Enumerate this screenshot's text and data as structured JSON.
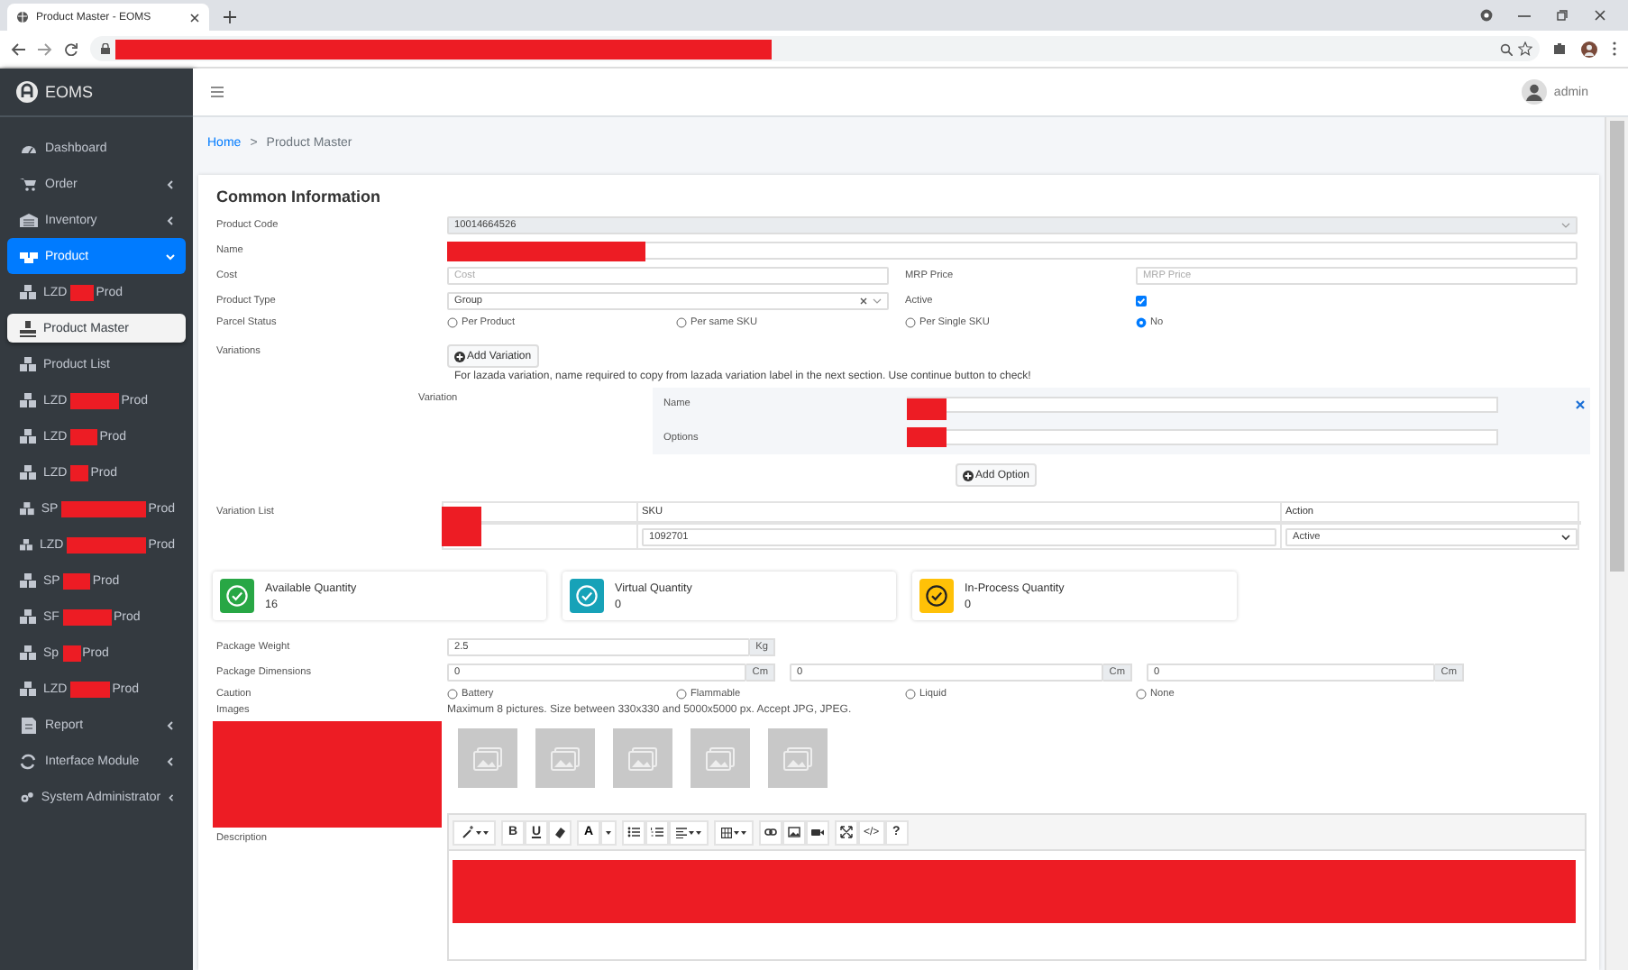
{
  "browser": {
    "tab_title": "Product Master - EOMS"
  },
  "app": {
    "brand": "EOMS",
    "user": "admin"
  },
  "breadcrumb": {
    "items": [
      {
        "label": "Home",
        "link": true
      },
      {
        "label": "Product Master",
        "link": false
      }
    ],
    "separator": ">"
  },
  "sidebar": {
    "items": [
      {
        "label": "Dashboard",
        "selected": false
      },
      {
        "label": "Order",
        "expanded": false,
        "selected": false
      },
      {
        "label": "Inventory",
        "expanded": false,
        "selected": false
      },
      {
        "label": "Product",
        "expanded": true,
        "selected": true,
        "children": [
          {
            "label": "LZD",
            "suffix": "Prod",
            "selected": false
          },
          {
            "label": "Product Master",
            "selected": true
          },
          {
            "label": "Product List",
            "selected": false
          },
          {
            "label": "LZD",
            "suffix": "Prod",
            "selected": false
          },
          {
            "label": "LZD",
            "suffix": "Prod",
            "selected": false
          },
          {
            "label": "LZD",
            "suffix": "Prod",
            "selected": false
          },
          {
            "label": "SP",
            "suffix": "Prod",
            "selected": false
          },
          {
            "label": "LZD",
            "suffix": "Prod",
            "selected": false
          },
          {
            "label": "SP",
            "suffix": "Prod",
            "selected": false
          },
          {
            "label": "SF",
            "suffix": "Prod",
            "selected": false
          },
          {
            "label": "Sp",
            "suffix": "Prod",
            "selected": false
          },
          {
            "label": "LZD",
            "suffix": "Prod",
            "selected": false
          }
        ]
      },
      {
        "label": "Report",
        "expanded": false,
        "selected": false
      },
      {
        "label": "Interface Module",
        "expanded": false,
        "selected": false
      },
      {
        "label": "System Administrator",
        "expanded": false,
        "selected": false
      }
    ]
  },
  "form": {
    "title": "Common Information",
    "product_code": {
      "label": "Product Code",
      "value": "10014664526"
    },
    "name": {
      "label": "Name"
    },
    "cost": {
      "label": "Cost",
      "placeholder": "Cost"
    },
    "mrp_price": {
      "label": "MRP Price",
      "placeholder": "MRP Price"
    },
    "product_type": {
      "label": "Product Type",
      "value": "Group"
    },
    "active": {
      "label": "Active",
      "checked": true
    },
    "parcel_status": {
      "label": "Parcel Status",
      "options": [
        {
          "label": "Per Product",
          "selected": false
        },
        {
          "label": "Per same SKU",
          "selected": false
        },
        {
          "label": "Per Single SKU",
          "selected": false
        },
        {
          "label": "No",
          "selected": true
        }
      ]
    },
    "variations": {
      "label": "Variations",
      "button": "Add Variation",
      "note": "For lazada variation, name required to copy from lazada variation label in the next section. Use continue button to check!",
      "variation_label": "Variation",
      "field_labels": [
        "Name",
        "Options"
      ],
      "add_option": "Add Option"
    },
    "variation_list": {
      "label": "Variation List",
      "columns": [
        "SKU",
        "Action"
      ],
      "rows": [
        {
          "sku": "1092701",
          "action": "Active"
        }
      ]
    },
    "quantities": [
      {
        "label": "Available Quantity",
        "value": "16",
        "color": "#28a745"
      },
      {
        "label": "Virtual Quantity",
        "value": "0",
        "color": "#17a2b8"
      },
      {
        "label": "In-Process Quantity",
        "value": "0",
        "color": "#ffc107"
      }
    ],
    "package_weight": {
      "label": "Package Weight",
      "value": "2.5",
      "unit": "Kg"
    },
    "package_dimensions": {
      "label": "Package Dimensions",
      "fields": [
        {
          "value": "0",
          "unit": "Cm"
        },
        {
          "value": "0",
          "unit": "Cm"
        },
        {
          "value": "0",
          "unit": "Cm"
        }
      ]
    },
    "caution": {
      "label": "Caution",
      "options": [
        {
          "label": "Battery",
          "selected": false
        },
        {
          "label": "Flammable",
          "selected": false
        },
        {
          "label": "Liquid",
          "selected": false
        },
        {
          "label": "None",
          "selected": false
        }
      ]
    },
    "images": {
      "label": "Images",
      "hint": "Maximum 8 pictures. Size between 330x330 and 5000x5000 px. Accept JPG, JPEG.",
      "slots": [
        {
          "kind": "empty"
        },
        {
          "kind": "empty"
        },
        {
          "kind": "empty"
        },
        {
          "kind": "empty"
        },
        {
          "kind": "empty"
        }
      ]
    },
    "description": {
      "label": "Description",
      "toolbar_text": {
        "bold": "B",
        "underline": "U",
        "font_color": "A",
        "code": "</>",
        "help": "?"
      }
    }
  }
}
